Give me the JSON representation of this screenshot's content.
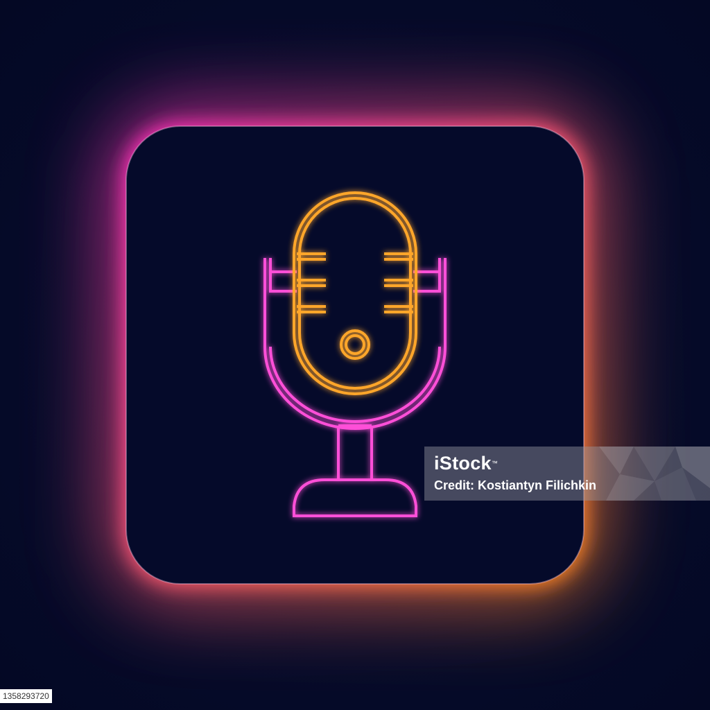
{
  "icon": {
    "name": "microphone-icon",
    "style": "neon line",
    "colors": {
      "background": "#060c2c",
      "frame_gradient_start": "#ff2fc0",
      "frame_gradient_end": "#ff8a1a",
      "mic_head": "#ffa62b",
      "mic_stand": "#ff4fd8"
    }
  },
  "watermark": {
    "brand": "iStock",
    "brand_mark": "™",
    "credit": "Credit: Kostiantyn Filichkin"
  },
  "stock_id": "1358293720"
}
